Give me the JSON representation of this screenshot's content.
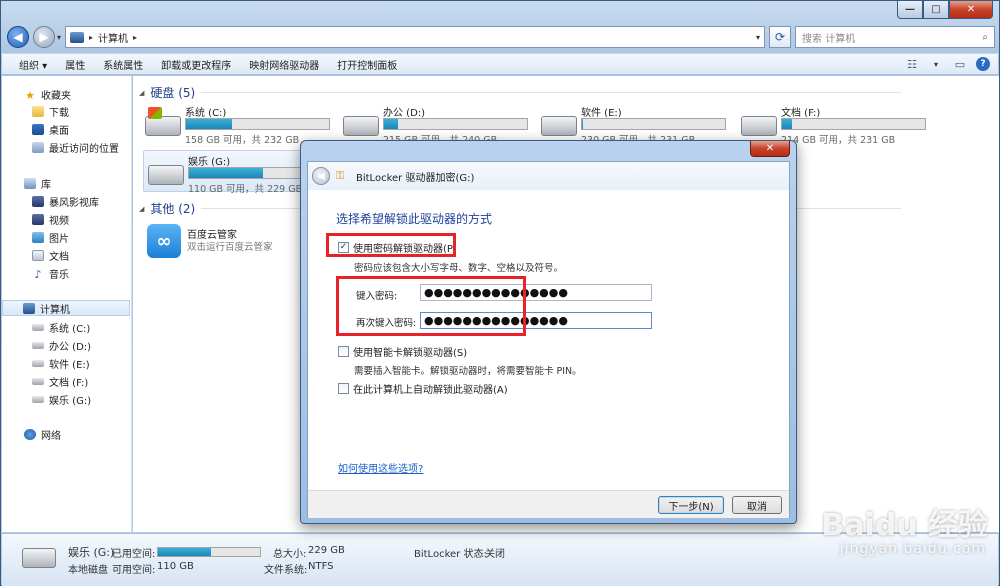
{
  "address": {
    "path": "计算机",
    "search_placeholder": "搜索 计算机"
  },
  "toolbar": {
    "organize": "组织 ▾",
    "properties": "属性",
    "system_properties": "系统属性",
    "uninstall": "卸载或更改程序",
    "map_drive": "映射网络驱动器",
    "control_panel": "打开控制面板"
  },
  "nav": {
    "favorites": "收藏夹",
    "downloads": "下载",
    "desktop": "桌面",
    "recent": "最近访问的位置",
    "libraries": "库",
    "storm_video_lib": "暴风影视库",
    "videos": "视频",
    "pictures": "图片",
    "documents": "文档",
    "music": "音乐",
    "computer": "计算机",
    "drives": [
      "系统 (C:)",
      "办公 (D:)",
      "软件 (E:)",
      "文档 (F:)",
      "娱乐 (G:)"
    ],
    "network": "网络"
  },
  "content": {
    "hdd_header": "硬盘 (5)",
    "other_header": "其他 (2)",
    "drives": [
      {
        "name": "系统 (C:)",
        "info": "158 GB 可用，共 232 GB",
        "used_fraction": 0.32
      },
      {
        "name": "办公 (D:)",
        "info": "215 GB 可用，共 240 GB",
        "used_fraction": 0.1
      },
      {
        "name": "软件 (E:)",
        "info": "230 GB 可用，共 231 GB",
        "used_fraction": 0.01
      },
      {
        "name": "文档 (F:)",
        "info": "214 GB 可用，共 231 GB",
        "used_fraction": 0.07
      },
      {
        "name": "娱乐 (G:)",
        "info": "110 GB 可用，共 229 GB",
        "used_fraction": 0.52
      }
    ],
    "app_name": "百度云管家",
    "app_desc": "双击运行百度云管家"
  },
  "details": {
    "drive_name": "娱乐 (G:)",
    "used_label": "已用空间:",
    "type": "本地磁盘",
    "free_label": "可用空间:",
    "free_value": "110 GB",
    "total_label": "总大小:",
    "total_value": "229 GB",
    "fs_label": "文件系统:",
    "fs_value": "NTFS",
    "bitlocker_label": "BitLocker 状态:",
    "bitlocker_value": "关闭",
    "used_fraction": 0.52
  },
  "dialog": {
    "title": "BitLocker 驱动器加密(G:)",
    "heading": "选择希望解锁此驱动器的方式",
    "use_password": "使用密码解锁驱动器(P)",
    "use_password_checked": true,
    "password_hint": "密码应该包含大小写字母、数字、空格以及符号。",
    "enter_password_label": "键入密码:",
    "enter_password_value": "●●●●●●●●●●●●●●●",
    "reenter_password_label": "再次键入密码:",
    "reenter_password_value": "●●●●●●●●●●●●●●●",
    "use_smartcard": "使用智能卡解锁驱动器(S)",
    "smartcard_hint": "需要插入智能卡。解锁驱动器时，将需要智能卡 PIN。",
    "auto_unlock": "在此计算机上自动解锁此驱动器(A)",
    "help_link": "如何使用这些选项?",
    "next_button": "下一步(N)",
    "cancel_button": "取消",
    "close_glyph": "✕"
  },
  "watermark": {
    "logo_text": "Baidu 经验",
    "url": "jingyan.baidu.com"
  }
}
